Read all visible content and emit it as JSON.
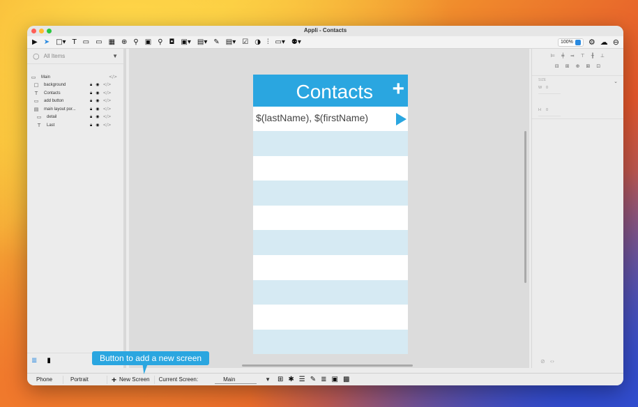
{
  "window": {
    "title": "Appli - Contacts"
  },
  "toolbar": {
    "tools": [
      {
        "icon": "play-icon",
        "glyph": "▶"
      },
      {
        "icon": "pointer-icon",
        "glyph": "➤"
      },
      {
        "icon": "shape-dropdown-icon",
        "glyph": "□▾"
      },
      {
        "icon": "text-icon",
        "glyph": "T"
      },
      {
        "icon": "button-icon",
        "glyph": "▭"
      },
      {
        "icon": "input-icon",
        "glyph": "▭"
      },
      {
        "icon": "table-icon",
        "glyph": "▦"
      },
      {
        "icon": "web-icon",
        "glyph": "⊕"
      },
      {
        "icon": "map-pin-icon",
        "glyph": "⚲"
      },
      {
        "icon": "chart-icon",
        "glyph": "▣"
      },
      {
        "icon": "search-tool-icon",
        "glyph": "⚲"
      },
      {
        "icon": "camera-icon",
        "glyph": "◘"
      },
      {
        "icon": "image-dropdown-icon",
        "glyph": "▣▾"
      },
      {
        "icon": "list-dropdown-icon",
        "glyph": "▤▾"
      },
      {
        "icon": "edit-icon",
        "glyph": "✎"
      },
      {
        "icon": "form-dropdown-icon",
        "glyph": "▤▾"
      },
      {
        "icon": "checkbox-icon",
        "glyph": "☑"
      },
      {
        "icon": "toggle-icon",
        "glyph": "◑"
      },
      {
        "icon": "sliders-icon",
        "glyph": "⫶"
      },
      {
        "icon": "calendar-dropdown-icon",
        "glyph": "▭▾"
      },
      {
        "icon": "users-dropdown-icon",
        "glyph": "⚉▾"
      }
    ],
    "zoom": "100%"
  },
  "sidebar": {
    "search_placeholder": "All Items",
    "layers": [
      {
        "name": "Main",
        "icon": "screen-icon",
        "glyph": "▭",
        "indent": 0,
        "locked": false,
        "visible": false
      },
      {
        "name": "background",
        "icon": "rectangle-icon",
        "glyph": "□",
        "indent": 1,
        "locked": true,
        "visible": true
      },
      {
        "name": "Contacts",
        "icon": "text-icon",
        "glyph": "T",
        "indent": 1,
        "locked": true,
        "visible": true
      },
      {
        "name": "add button",
        "icon": "button-icon",
        "glyph": "▭",
        "indent": 1,
        "locked": true,
        "visible": true
      },
      {
        "name": "main layout por...",
        "icon": "list-icon",
        "glyph": "▤",
        "indent": 1,
        "locked": true,
        "visible": true
      },
      {
        "name": "detail",
        "icon": "button-icon",
        "glyph": "▭",
        "indent": 2,
        "locked": true,
        "visible": true
      },
      {
        "name": "Last",
        "icon": "text-icon",
        "glyph": "T",
        "indent": 2,
        "locked": true,
        "visible": true
      }
    ]
  },
  "phone": {
    "title": "Contacts",
    "add_glyph": "+",
    "row_template": "$(lastName), $(firstName)"
  },
  "inspector": {
    "size_label": "SIZE",
    "w_label": "W",
    "w_value": "0",
    "h_label": "H",
    "h_value": "0"
  },
  "statusbar": {
    "device": "Phone",
    "orientation": "Portrait",
    "new_screen": "New Screen",
    "current_screen_label": "Current Screen:",
    "current_screen_value": "Main"
  },
  "tooltip": {
    "text": "Button to add a new screen"
  },
  "colors": {
    "accent": "#2aa6e0",
    "row_alt": "#d6eaf3"
  }
}
